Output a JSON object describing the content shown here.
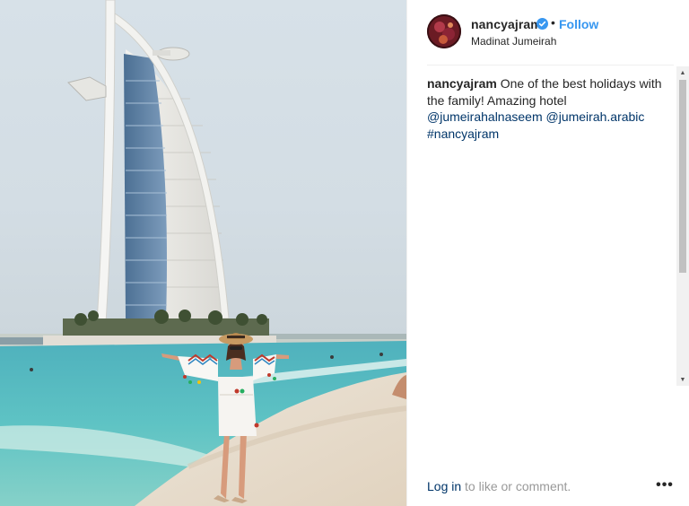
{
  "post": {
    "image_alt": "Woman in white dress on beach in front of Burj Al Arab hotel",
    "header": {
      "username": "nancyajram",
      "verified_icon": "verified-badge-icon",
      "separator": "•",
      "follow_label": "Follow",
      "location": "Madinat Jumeirah"
    },
    "caption": {
      "username": "nancyajram",
      "text": "One of the best holidays with the family! Amazing hotel",
      "mentions": [
        "@jumeirahalnaseem",
        "@jumeirah.arabic"
      ],
      "hashtag": "#nancyajram"
    },
    "footer": {
      "login_label": "Log in",
      "login_suffix": "to like or comment.",
      "more_label": "•••"
    }
  },
  "colors": {
    "link_blue": "#3897f0",
    "mention_blue": "#003569",
    "text": "#262626",
    "muted": "#999999"
  }
}
